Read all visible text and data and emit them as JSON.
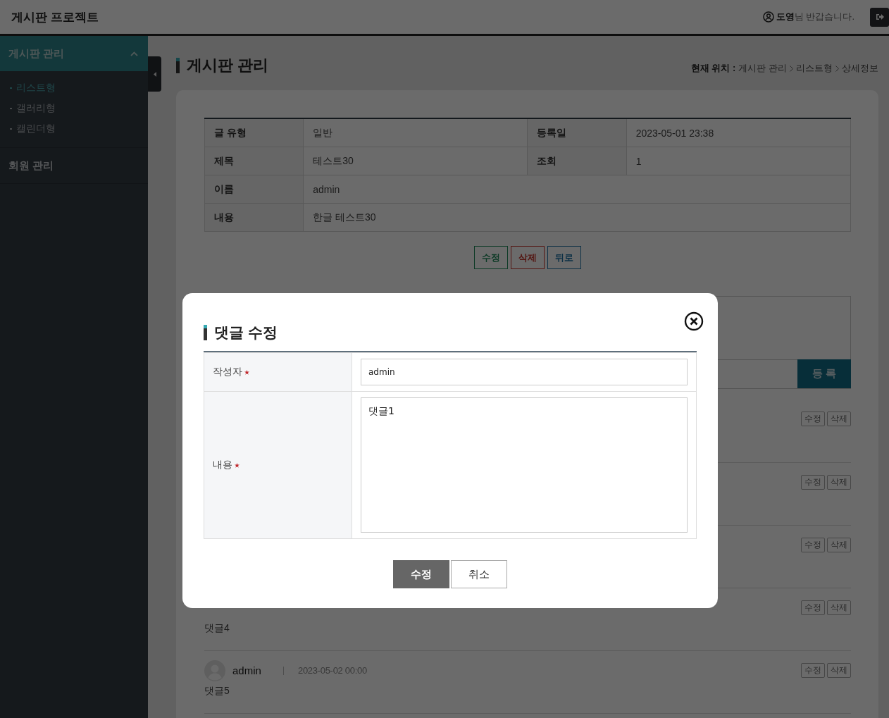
{
  "header": {
    "title": "게시판 프로젝트",
    "user_name": "도영",
    "greeting": "님 반갑습니다."
  },
  "sidebar": {
    "items": [
      {
        "label": "게시판 관리",
        "expanded": true,
        "children": [
          {
            "label": "리스트형",
            "selected": true
          },
          {
            "label": "갤러리형",
            "selected": false
          },
          {
            "label": "캘린더형",
            "selected": false
          }
        ]
      },
      {
        "label": "회원 관리",
        "expanded": false
      }
    ]
  },
  "page": {
    "title": "게시판 관리",
    "breadcrumb": {
      "label": "현재 위치 :",
      "path": [
        "게시판 관리",
        "리스트형",
        "상세정보"
      ]
    }
  },
  "detail": {
    "rows": [
      [
        {
          "label": "글 유형",
          "value": "일반"
        },
        {
          "label": "등록일",
          "value": "2023-05-01 23:38"
        }
      ],
      [
        {
          "label": "제목",
          "value": "테스트30"
        },
        {
          "label": "조회",
          "value": "1"
        }
      ],
      [
        {
          "label": "이름",
          "value": "admin"
        }
      ],
      [
        {
          "label": "내용",
          "value": "한글 테스트30"
        }
      ]
    ]
  },
  "actions": [
    {
      "label": "수정",
      "kind": "edit"
    },
    {
      "label": "삭제",
      "kind": "delete"
    },
    {
      "label": "뒤로",
      "kind": "back"
    }
  ],
  "comment_form": {
    "submit": "등 록"
  },
  "comments": [
    {
      "actions": [
        "수정",
        "삭제"
      ]
    },
    {
      "actions": [
        "수정",
        "삭제"
      ]
    },
    {
      "actions": [
        "수정",
        "삭제"
      ]
    },
    {
      "body": "댓글4",
      "actions": [
        "수정",
        "삭제"
      ]
    },
    {
      "author": "admin",
      "date": "2023-05-02 00:00",
      "body": "댓글5",
      "actions": [
        "수정",
        "삭제"
      ]
    }
  ],
  "modal": {
    "title": "댓글 수정",
    "fields": [
      {
        "label": "작성자",
        "required": true,
        "kind": "input",
        "value": "admin"
      },
      {
        "label": "내용",
        "required": true,
        "kind": "textarea",
        "value": "댓글1"
      }
    ],
    "buttons": [
      {
        "label": "수정",
        "kind": "primary"
      },
      {
        "label": "취소",
        "kind": "secondary"
      }
    ]
  }
}
